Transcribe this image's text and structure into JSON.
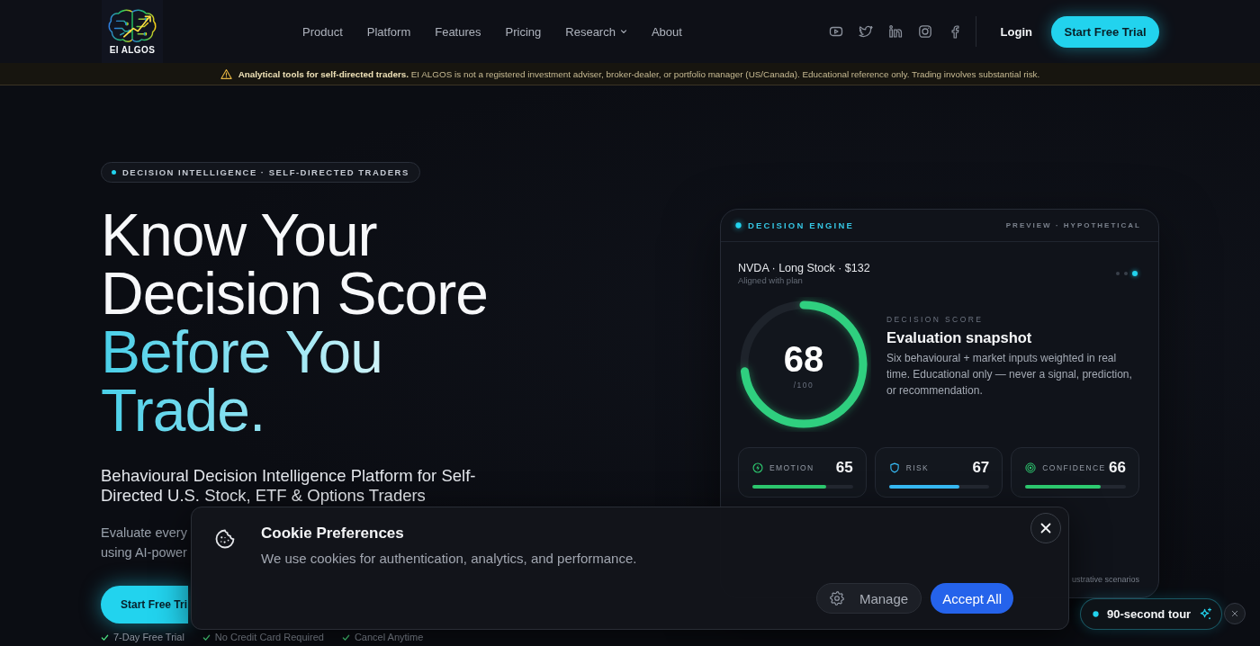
{
  "header": {
    "logo": "EI ALGOS",
    "nav": [
      {
        "label": "Product",
        "has_menu": false
      },
      {
        "label": "Platform",
        "has_menu": false
      },
      {
        "label": "Features",
        "has_menu": false
      },
      {
        "label": "Pricing",
        "has_menu": false
      },
      {
        "label": "Research",
        "has_menu": true
      },
      {
        "label": "About",
        "has_menu": false
      }
    ],
    "login": "Login",
    "cta": "Start Free Trial"
  },
  "disclaimer": "**Analytical tools for self-directed traders.** EI ALGOS is not a registered investment adviser, broker-dealer, or portfolio manager (US/Canada). Educational reference only. Trading involves substantial risk.",
  "hero": {
    "tag": "DECISION INTELLIGENCE · SELF-DIRECTED TRADERS",
    "heading": "Know Your Decision Score",
    "heading_highlight": "Before You Trade.",
    "subtitle": "Behavioural Decision Intelligence Platform for Self-Directed U.S. Stock, ETF & Options Traders",
    "intro": [
      "Evaluate every",
      "using AI-power"
    ],
    "cta": "Start Free Tri",
    "perks": [
      "7-Day Free Trial",
      "No Credit Card Required",
      "Cancel Anytime"
    ]
  },
  "decision_engine": {
    "title": "DECISION ENGINE",
    "tag": "PREVIEW · HYPOTHETICAL",
    "trade": "NVDA · Long Stock · $132",
    "status": "Aligned with plan",
    "slides": [
      {
        "selected": false
      },
      {
        "selected": false
      },
      {
        "selected": true
      }
    ],
    "score": {
      "value": "68",
      "max": "/100",
      "level": 0.73
    },
    "score_label": "DECISION SCORE",
    "score_heading": "Evaluation snapshot",
    "score_description": "Six behavioural + market inputs weighted in real time. Educational only — never a signal, prediction, or recommendation.",
    "metrics": [
      {
        "kind": "emotion",
        "label": "EMOTION",
        "value": "65",
        "level": 0.73,
        "color": "#2ecc71"
      },
      {
        "kind": "risk",
        "label": "RISK",
        "value": "67",
        "level": 0.7,
        "color": "#38bdf8"
      },
      {
        "kind": "confidence",
        "label": "CONFIDENCE",
        "value": "66",
        "level": 0.75,
        "color": "#2ecc71"
      }
    ],
    "footnote": "ustrative scenarios"
  },
  "cookie_banner": {
    "title": "Cookie Preferences",
    "message": "We use cookies for authentication, analytics, and performance.",
    "buttons": [
      {
        "label": "Manage",
        "kind": "secondary"
      },
      {
        "label": "Accept All",
        "kind": "primary"
      }
    ]
  },
  "tour": {
    "label": "90-second tour"
  }
}
